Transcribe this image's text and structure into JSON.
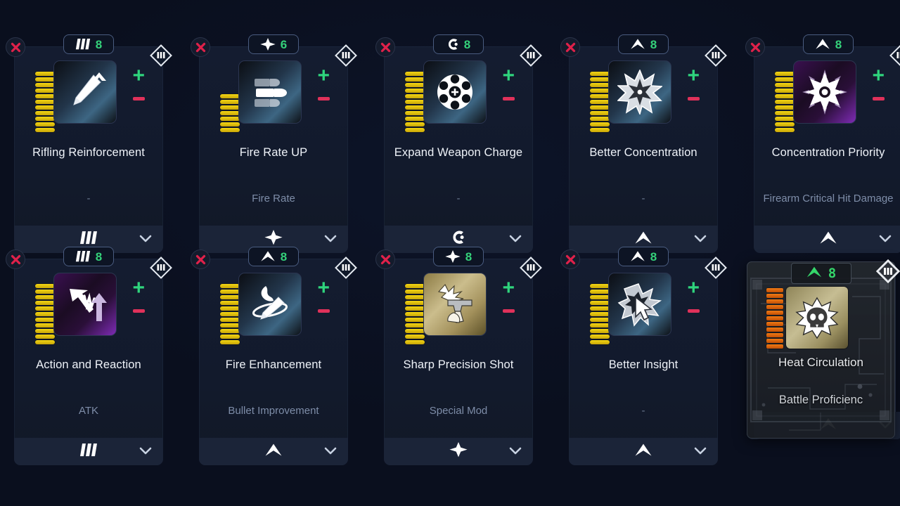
{
  "screen": {
    "background_color": "#0a0f1e",
    "accent_green": "#34d17a",
    "accent_red": "#e0315a",
    "bar_color": "#f2d513",
    "drag_bar_color": "#f07a14"
  },
  "controls": {
    "close_label": "remove-mod",
    "plus_label": "+",
    "minus_label": "–",
    "expand_label": "expand"
  },
  "cards": [
    {
      "title": "Rifling Reinforcement",
      "subtitle": "-",
      "subtitle_is_dash": true,
      "badge_value": "8",
      "badge_icon": "triple-slash-icon",
      "footer_icon": "triple-slash-icon",
      "bars": 11,
      "thumb_style": "blue",
      "thumb_icon": "bullet-up-icon"
    },
    {
      "title": "Fire Rate UP",
      "subtitle": "Fire Rate",
      "subtitle_is_dash": false,
      "badge_value": "6",
      "badge_icon": "four-point-star-icon",
      "footer_icon": "four-point-star-icon",
      "bars": 7,
      "thumb_style": "blue",
      "thumb_icon": "three-bullets-icon"
    },
    {
      "title": "Expand Weapon Charge",
      "subtitle": "-",
      "subtitle_is_dash": true,
      "badge_value": "8",
      "badge_icon": "c-crescent-icon",
      "footer_icon": "c-crescent-icon",
      "bars": 11,
      "thumb_style": "blue",
      "thumb_icon": "revolver-cylinder-icon"
    },
    {
      "title": "Better Concentration",
      "subtitle": "-",
      "subtitle_is_dash": true,
      "badge_value": "8",
      "badge_icon": "chevron-peak-icon",
      "footer_icon": "chevron-peak-icon",
      "bars": 11,
      "thumb_style": "blue",
      "thumb_icon": "burst-star-icon"
    },
    {
      "title": "Concentration Priority",
      "subtitle": "Firearm Critical Hit Damage",
      "subtitle_is_dash": false,
      "badge_value": "8",
      "badge_icon": "chevron-peak-icon",
      "footer_icon": "chevron-peak-icon",
      "bars": 11,
      "thumb_style": "purple",
      "thumb_icon": "radiant-star-icon"
    },
    {
      "title": "Action and Reaction",
      "subtitle": "ATK",
      "subtitle_is_dash": false,
      "badge_value": "8",
      "badge_icon": "triple-slash-icon",
      "footer_icon": "triple-slash-icon",
      "bars": 11,
      "thumb_style": "purple",
      "thumb_icon": "impact-arrows-icon"
    },
    {
      "title": "Fire Enhancement",
      "subtitle": "Bullet Improvement",
      "subtitle_is_dash": false,
      "badge_value": "8",
      "badge_icon": "chevron-peak-icon",
      "footer_icon": "chevron-peak-icon",
      "bars": 11,
      "thumb_style": "blue",
      "thumb_icon": "flaming-bullet-icon"
    },
    {
      "title": "Sharp Precision Shot",
      "subtitle": "Special Mod",
      "subtitle_is_dash": false,
      "badge_value": "8",
      "badge_icon": "four-point-star-icon",
      "footer_icon": "four-point-star-icon",
      "bars": 11,
      "thumb_style": "gold",
      "thumb_icon": "pistol-firing-icon"
    },
    {
      "title": "Better Insight",
      "subtitle": "-",
      "subtitle_is_dash": true,
      "badge_value": "8",
      "badge_icon": "chevron-peak-icon",
      "footer_icon": "chevron-peak-icon",
      "bars": 11,
      "thumb_style": "blue",
      "thumb_icon": "cursor-burst-icon"
    }
  ],
  "dragged_card": {
    "title": "Heat Circulation",
    "subtitle": "Battle Proficienc",
    "badge_value": "8",
    "badge_icon": "chevron-peak-icon",
    "footer_icon": "chevron-peak-icon",
    "bars": 11,
    "thumb_style": "gold",
    "thumb_icon": "skull-burst-icon"
  }
}
